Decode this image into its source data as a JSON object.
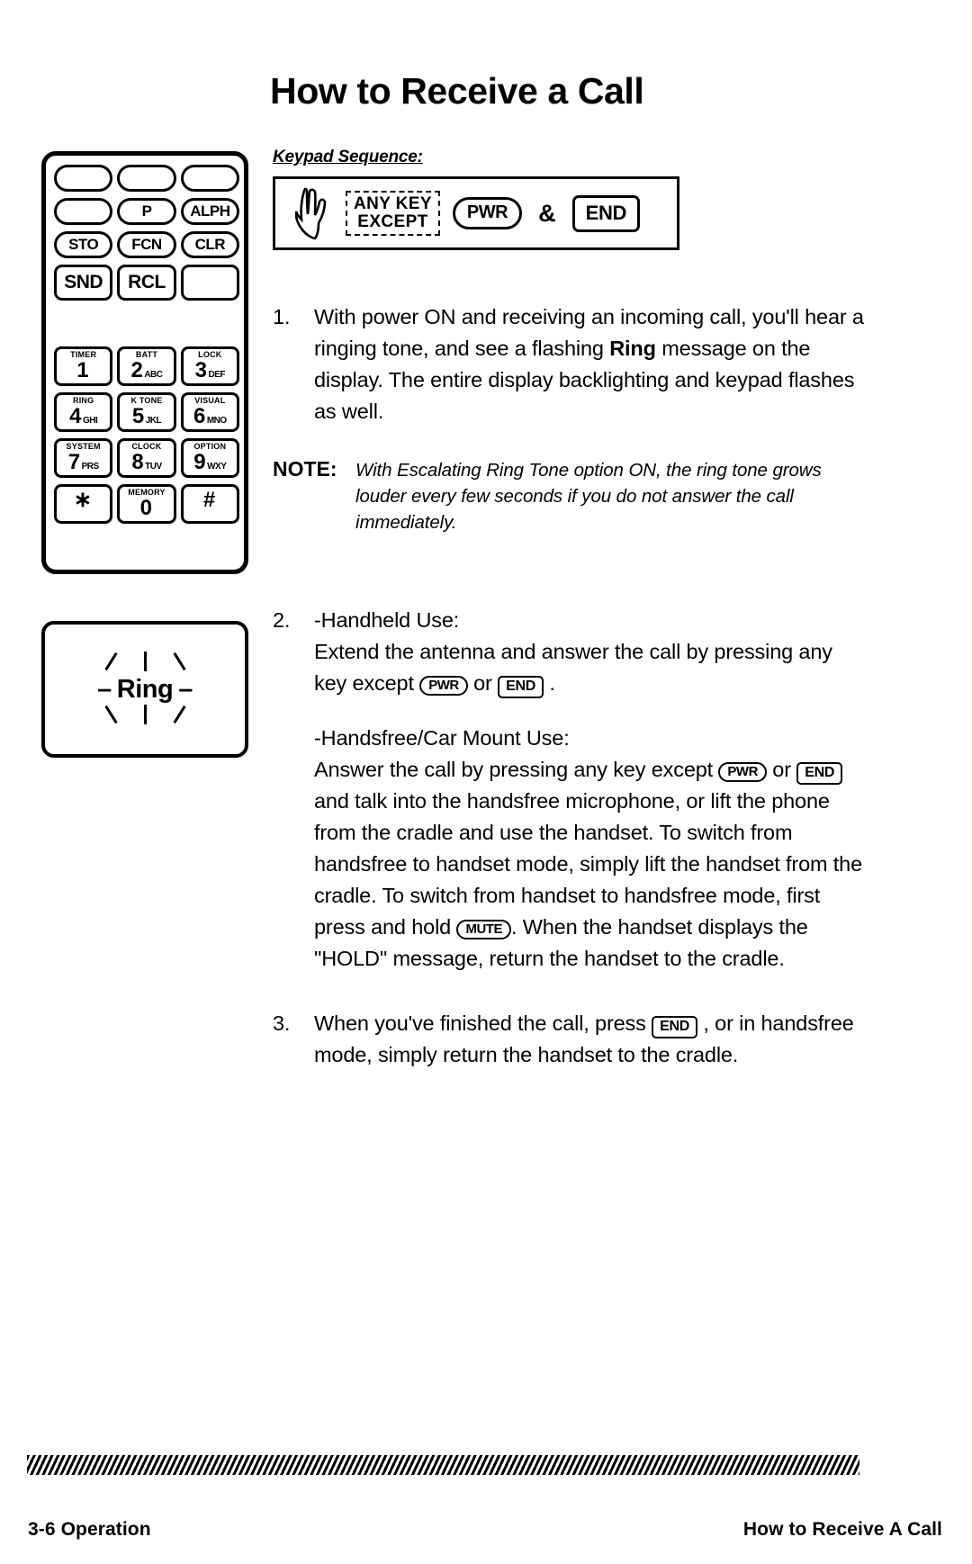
{
  "page": {
    "title": "How to Receive a Call",
    "keypad_sequence_label": "Keypad Sequence:"
  },
  "keypad_sequence": {
    "hand_icon": "pointing-hand-icon",
    "any_key_line1": "ANY KEY",
    "any_key_line2": "EXCEPT",
    "pwr_key": "PWR",
    "ampersand": "&",
    "end_key": "END"
  },
  "phone": {
    "keys": [
      {
        "label": "",
        "type": "oval"
      },
      {
        "label": "",
        "type": "oval"
      },
      {
        "label": "",
        "type": "oval"
      },
      {
        "label": "",
        "type": "oval"
      },
      {
        "label": "P",
        "type": "oval"
      },
      {
        "label": "ALPH",
        "type": "oval"
      },
      {
        "label": "STO",
        "type": "oval"
      },
      {
        "label": "FCN",
        "type": "oval"
      },
      {
        "label": "CLR",
        "type": "oval"
      },
      {
        "label": "SND",
        "type": "soft"
      },
      {
        "label": "RCL",
        "type": "soft"
      },
      {
        "label": "",
        "type": "soft"
      }
    ],
    "numpad": [
      {
        "function": "TIMER",
        "digit": "1",
        "letters": ""
      },
      {
        "function": "BATT",
        "digit": "2",
        "letters": "ABC"
      },
      {
        "function": "LOCK",
        "digit": "3",
        "letters": "DEF"
      },
      {
        "function": "RING",
        "digit": "4",
        "letters": "GHI"
      },
      {
        "function": "K TONE",
        "digit": "5",
        "letters": "JKL"
      },
      {
        "function": "VISUAL",
        "digit": "6",
        "letters": "MNO"
      },
      {
        "function": "SYSTEM",
        "digit": "7",
        "letters": "PRS"
      },
      {
        "function": "CLOCK",
        "digit": "8",
        "letters": "TUV"
      },
      {
        "function": "OPTION",
        "digit": "9",
        "letters": "WXY"
      },
      {
        "function": "",
        "digit": "∗",
        "letters": ""
      },
      {
        "function": "MEMORY",
        "digit": "0",
        "letters": ""
      },
      {
        "function": "",
        "digit": "#",
        "letters": ""
      }
    ]
  },
  "ring_display": {
    "text": "Ring",
    "left_dash": "–",
    "right_dash": "–"
  },
  "steps": {
    "one": {
      "index": "1.",
      "text_a": "With power ON and receiving an incoming call, you'll hear a ringing tone, and see a flashing ",
      "bold_word": "Ring",
      "text_b": " message on the display.  The entire display backlighting and keypad flashes as well."
    },
    "two": {
      "index": "2.",
      "heading_handheld": "-Handheld Use:",
      "handheld_a": "Extend the antenna and answer the call by pressing any key except ",
      "handheld_pwr": "PWR",
      "handheld_or": " or ",
      "handheld_end": "END",
      "handheld_b": " .",
      "heading_carmount": "-Handsfree/Car Mount Use:",
      "carmount_a": "Answer the call by pressing any key except ",
      "carmount_pwr": "PWR",
      "carmount_or": " or",
      "carmount_end": "END",
      "carmount_b": " and talk into the handsfree microphone, or lift the phone from the cradle and use the handset.  To switch from handsfree to handset mode, simply lift  the handset from the cradle.  To switch from handset to handsfree mode, first press and hold ",
      "carmount_mute": "MUTE",
      "carmount_c": ".  When the handset displays the \"HOLD\" message, return the handset to the cradle."
    },
    "three": {
      "index": "3.",
      "text_a": "When you've finished the call, press ",
      "end_key": "END",
      "text_b": " , or in handsfree mode, simply return the handset to the cradle."
    }
  },
  "note": {
    "label": "NOTE:",
    "text": "With Escalating Ring Tone option ON, the ring tone grows louder every few seconds if you do not answer the call immediately."
  },
  "footer": {
    "left": "3-6   Operation",
    "right": "How to Receive A Call"
  },
  "colors": {
    "ink": "#000000",
    "paper": "#ffffff"
  }
}
